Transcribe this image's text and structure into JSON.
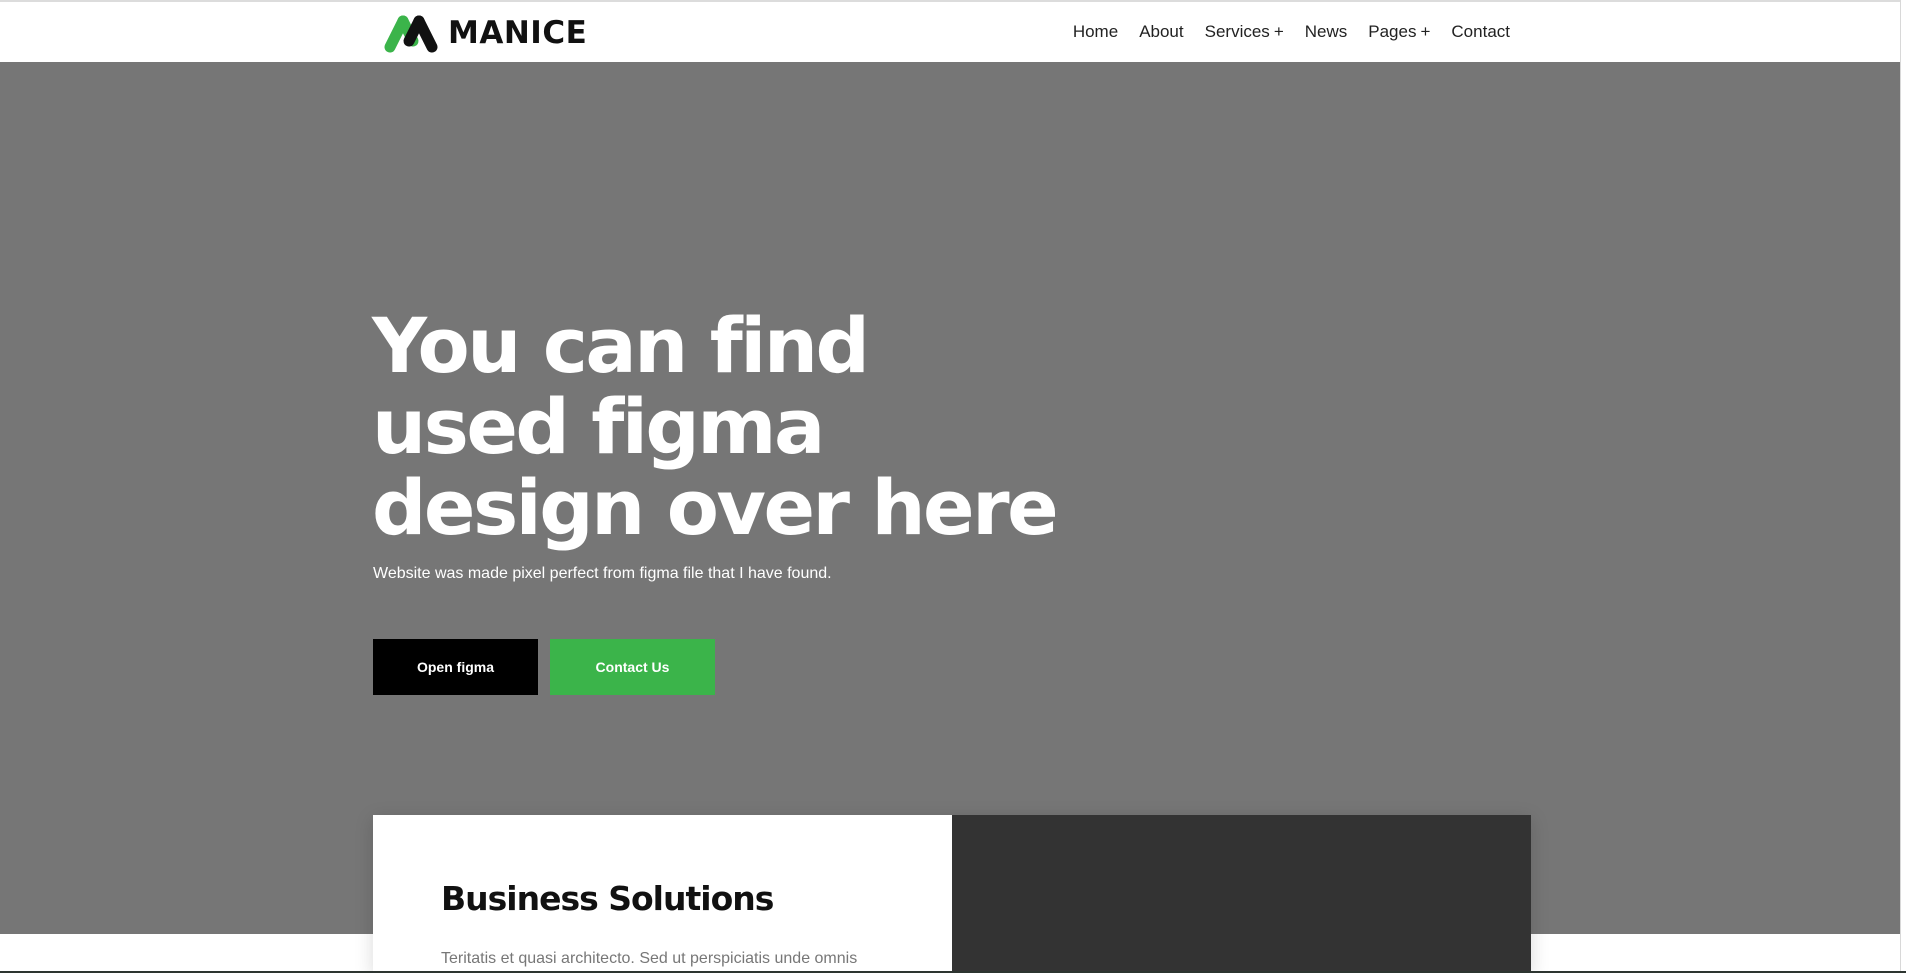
{
  "brand": {
    "name": "MANICE",
    "logo_icon": "manice-logo-icon",
    "colors": {
      "primary": "#000000",
      "accent": "#3bb44a",
      "hero_bg": "#767676",
      "card_dark": "#333333"
    }
  },
  "nav": {
    "items": [
      {
        "label": "Home",
        "has_submenu": false
      },
      {
        "label": "About",
        "has_submenu": false
      },
      {
        "label": "Services",
        "has_submenu": true,
        "submenu_marker": "+"
      },
      {
        "label": "News",
        "has_submenu": false
      },
      {
        "label": "Pages",
        "has_submenu": true,
        "submenu_marker": "+"
      },
      {
        "label": "Contact",
        "has_submenu": false
      }
    ]
  },
  "hero": {
    "title": "You can find used figma design over here",
    "subtitle": "Website was made pixel perfect from figma file that I have found.",
    "primary_button": "Open figma",
    "secondary_button": "Contact Us"
  },
  "card": {
    "title": "Business Solutions",
    "text": "Teritatis et quasi architecto. Sed ut perspiciatis unde omnis"
  }
}
